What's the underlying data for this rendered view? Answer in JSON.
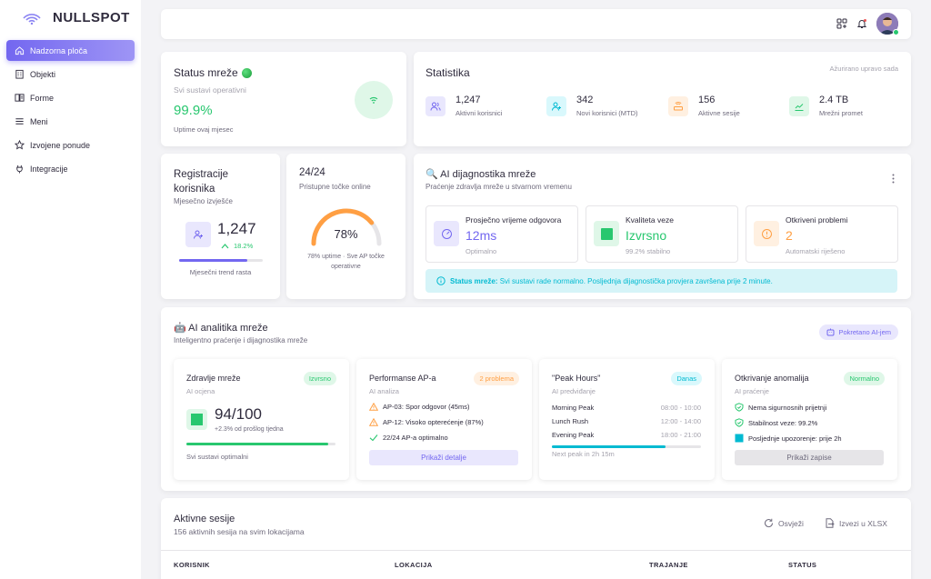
{
  "brand": {
    "name": "NULLSPOT",
    "accent": "#7367f0"
  },
  "sidebar": {
    "items": [
      {
        "label": "Nadzorna ploča",
        "icon": "home-icon",
        "active": true
      },
      {
        "label": "Objekti",
        "icon": "building-icon"
      },
      {
        "label": "Forme",
        "icon": "forms-icon"
      },
      {
        "label": "Meni",
        "icon": "menu-icon"
      },
      {
        "label": "Izvojene ponude",
        "icon": "star-icon"
      },
      {
        "label": "Integracije",
        "icon": "plug-icon"
      }
    ]
  },
  "topbar": {
    "icons": [
      "apps-add-icon",
      "bell-icon",
      "user-avatar"
    ]
  },
  "network_status": {
    "title": "Status mreže",
    "subtitle": "Svi sustavi operativni",
    "value": "99.9%",
    "caption": "Uptime ovaj mjesec"
  },
  "statistics": {
    "title": "Statistika",
    "updated": "Ažurirano upravo sada",
    "items": [
      {
        "value": "1,247",
        "label": "Aktivni korisnici",
        "icon": "users-icon",
        "color": "#7367f0"
      },
      {
        "value": "342",
        "label": "Novi korisnici (MTD)",
        "icon": "user-plus-icon",
        "color": "#00bad1"
      },
      {
        "value": "156",
        "label": "Aktivne sesije",
        "icon": "router-icon",
        "color": "#ff9f43"
      },
      {
        "value": "2.4 TB",
        "label": "Mrežni promet",
        "icon": "chart-line-icon",
        "color": "#28c76f"
      }
    ]
  },
  "registrations": {
    "title_line1": "Registracije",
    "title_line2": "korisnika",
    "subtitle": "Mjesečno izvješće",
    "value": "1,247",
    "change": "18.2%",
    "trend_fraction": 0.82,
    "caption": "Mjesečni trend rasta"
  },
  "access_points": {
    "title": "24/24",
    "subtitle": "Pristupne točke online",
    "percent": "78%",
    "gauge_fraction": 0.78,
    "caption_line1": "78% uptime · Sve AP točke",
    "caption_line2": "operativne"
  },
  "ai_diagnostics": {
    "title": "🔍 AI dijagnostika mreže",
    "subtitle": "Praćenje zdravlja mreže u stvarnom vremenu",
    "boxes": [
      {
        "title": "Prosječno vrijeme odgovora",
        "value": "12ms",
        "sub": "Optimalno",
        "color": "#7367f0"
      },
      {
        "title": "Kvaliteta veze",
        "value": "Izvrsno",
        "sub": "99.2% stabilno",
        "color": "#28c76f"
      },
      {
        "title": "Otkriveni problemi",
        "value": "2",
        "sub": "Automatski riješeno",
        "color": "#ff9f43"
      }
    ],
    "alert_strong": "Status mreže:",
    "alert_text": " Svi sustavi rade normalno. Posljednja dijagnostička provjera završena prije 2 minute."
  },
  "ai_analytics": {
    "title": "🤖 AI analitika mreže",
    "subtitle": "Inteligentno praćenje i dijagnostika mreže",
    "powered": "Pokretano AI-jem",
    "health": {
      "title": "Zdravlje mreže",
      "sub": "AI ocjena",
      "badge": "Izvrsno",
      "score": "94/100",
      "change": "+2.3% od prošlog tjedna",
      "progress": 0.95,
      "footer": "Svi sustavi optimalni"
    },
    "performance": {
      "title": "Performanse AP-a",
      "sub": "AI analiza",
      "badge": "2 problema",
      "rows": [
        {
          "text": "AP-03: Spor odgovor (45ms)",
          "icon": "warning-icon"
        },
        {
          "text": "AP-12: Visoko opterećenje (87%)",
          "icon": "warning-icon"
        },
        {
          "text": "22/24 AP-a optimalno",
          "icon": "check-icon"
        }
      ],
      "button": "Prikaži detalje"
    },
    "peak": {
      "title": "\"Peak Hours\"",
      "sub": "AI predviđanje",
      "badge": "Danas",
      "rows": [
        {
          "name": "Morning Peak",
          "time": "08:00 - 10:00"
        },
        {
          "name": "Lunch Rush",
          "time": "12:00 - 14:00"
        },
        {
          "name": "Evening Peak",
          "time": "18:00 - 21:00"
        }
      ],
      "progress": 0.76,
      "footer": "Next peak in 2h 15m"
    },
    "anomaly": {
      "title": "Otkrivanje anomalija",
      "sub": "AI praćenje",
      "badge": "Normalno",
      "rows": [
        {
          "text": "Nema sigurnosnih prijetnji",
          "icon": "shield-check-icon"
        },
        {
          "text": "Stabilnost veze: 99.2%",
          "icon": "shield-check-icon"
        },
        {
          "text": "Posljednje upozorenje: prije 2h",
          "icon": "info-square-icon"
        }
      ],
      "button": "Prikaži zapise"
    }
  },
  "sessions": {
    "title": "Aktivne sesije",
    "subtitle": "156 aktivnih sesija na svim lokacijama",
    "refresh": "Osvježi",
    "export": "Izvezi u XLSX",
    "columns": [
      "KORISNIK",
      "LOKACIJA",
      "TRAJANJE",
      "STATUS"
    ]
  }
}
